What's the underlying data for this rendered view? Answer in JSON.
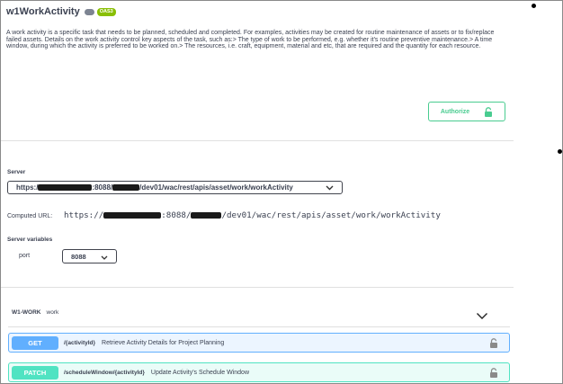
{
  "info": {
    "title": "w1WorkActivity",
    "oas_badge": "OAS3",
    "description": "A work activity is a specific task that needs to be planned, scheduled and completed. For examples, activities may be created for routine maintenance of assets or to fix/replace failed assets. Details on the work activity control key aspects of the task, such as:> The type of work to be performed, e.g. whether it's routine preventive maintenance.> A time window, during which the activity is preferred to be worked on.> The resources, i.e. craft, equipment, material and etc, that are required and the quantity for each resource."
  },
  "authorize": {
    "label": "Authorize",
    "icon": "lock-icon"
  },
  "servers": {
    "label": "Server",
    "selected_prefix": "https:/",
    "selected_mid": ":8088/",
    "selected_suffix": "/dev01/wac/rest/apis/asset/work/workActivity"
  },
  "computed_url": {
    "label": "Computed URL:",
    "prefix": "https://",
    "mid": ":8088/",
    "suffix": "/dev01/wac/rest/apis/asset/work/workActivity"
  },
  "server_variables": {
    "label": "Server variables",
    "port_label": "port",
    "port_value": "8088"
  },
  "tag": {
    "name": "W1-WORK",
    "description": "work"
  },
  "operations": [
    {
      "method": "GET",
      "path": "/{activityId}",
      "summary": "Retrieve Activity Details for Project Planning",
      "color": "#61affe"
    },
    {
      "method": "PATCH",
      "path": "/scheduleWindow/{activityId}",
      "summary": "Update Activity's Schedule Window",
      "color": "#50e3c2"
    }
  ]
}
